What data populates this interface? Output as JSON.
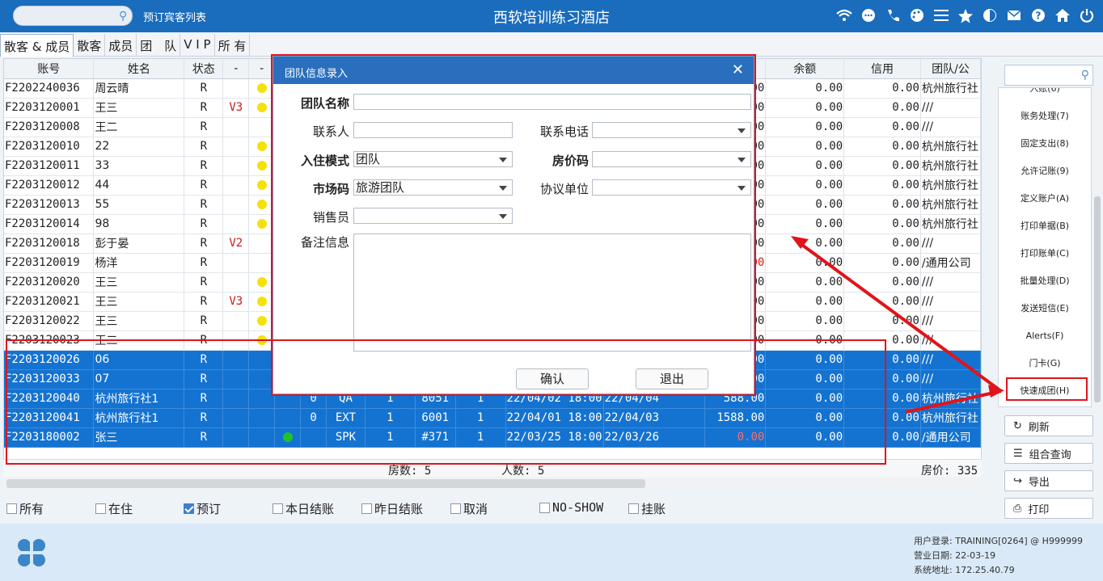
{
  "topbar": {
    "link": "预订宾客列表",
    "title": "西软培训练习酒店"
  },
  "tabs": [
    "散客 & 成员",
    "散客",
    "成员",
    "团　队",
    "V I P",
    "所 有"
  ],
  "table": {
    "headers": [
      "账号",
      "姓名",
      "状态",
      "-",
      "-",
      "",
      "",
      "",
      "",
      "",
      "",
      "",
      "",
      "",
      "余额",
      "信用",
      "团队/公"
    ],
    "rows": [
      [
        "F2202240036",
        "周云晴",
        "R",
        "",
        "yellow",
        "",
        "",
        "",
        "",
        "",
        "",
        "",
        "",
        "00",
        "0.00",
        "0.00",
        "杭州旅行社"
      ],
      [
        "F2203120001",
        "王三",
        "R",
        "V3",
        "yellow",
        "",
        "",
        "",
        "",
        "",
        "",
        "",
        "",
        "00",
        "0.00",
        "0.00",
        "///"
      ],
      [
        "F2203120008",
        "王二",
        "R",
        "",
        "",
        "",
        "",
        "",
        "",
        "",
        "",
        "",
        "",
        "00",
        "0.00",
        "0.00",
        "///"
      ],
      [
        "F2203120010",
        "22",
        "R",
        "",
        "yellow",
        "",
        "",
        "",
        "",
        "",
        "",
        "",
        "",
        "00",
        "0.00",
        "0.00",
        "杭州旅行社"
      ],
      [
        "F2203120011",
        "33",
        "R",
        "",
        "yellow",
        "",
        "",
        "",
        "",
        "",
        "",
        "",
        "",
        "00",
        "0.00",
        "0.00",
        "杭州旅行社"
      ],
      [
        "F2203120012",
        "44",
        "R",
        "",
        "yellow",
        "",
        "",
        "",
        "",
        "",
        "",
        "",
        "",
        "00",
        "0.00",
        "0.00",
        "杭州旅行社"
      ],
      [
        "F2203120013",
        "55",
        "R",
        "",
        "yellow",
        "",
        "",
        "",
        "",
        "",
        "",
        "",
        "",
        "00",
        "0.00",
        "0.00",
        "杭州旅行社"
      ],
      [
        "F2203120014",
        "98",
        "R",
        "",
        "yellow",
        "",
        "",
        "",
        "",
        "",
        "",
        "",
        "",
        "00",
        "0.00",
        "0.00",
        "杭州旅行社"
      ],
      [
        "F2203120018",
        "彭于晏",
        "R",
        "V2",
        "",
        "",
        "",
        "",
        "",
        "",
        "",
        "",
        "",
        "00",
        "0.00",
        "0.00",
        "///"
      ],
      [
        "F2203120019",
        "杨洋",
        "R",
        "",
        "",
        "",
        "",
        "",
        "",
        "",
        "",
        "",
        "",
        "00",
        "0.00",
        "0.00",
        "/通用公司"
      ],
      [
        "F2203120020",
        "王三",
        "R",
        "",
        "yellow",
        "",
        "",
        "",
        "",
        "",
        "",
        "",
        "",
        "00",
        "0.00",
        "0.00",
        "///"
      ],
      [
        "F2203120021",
        "王三",
        "R",
        "V3",
        "yellow",
        "",
        "",
        "",
        "",
        "",
        "",
        "",
        "",
        "00",
        "0.00",
        "0.00",
        "///"
      ],
      [
        "F2203120022",
        "王三",
        "R",
        "",
        "yellow",
        "",
        "",
        "",
        "",
        "",
        "",
        "",
        "",
        "00",
        "0.00",
        "0.00",
        "///"
      ],
      [
        "F2203120023",
        "王二",
        "R",
        "",
        "yellow",
        "",
        "",
        "",
        "",
        "",
        "",
        "",
        "",
        "00",
        "0.00",
        "0.00",
        "///"
      ],
      [
        "F2203120026",
        "06",
        "R",
        "",
        "",
        "",
        "",
        "",
        "",
        "",
        "",
        "",
        "",
        "00",
        "0.00",
        "0.00",
        "///"
      ],
      [
        "F2203120033",
        "07",
        "R",
        "",
        "",
        "",
        "",
        "",
        "",
        "",
        "",
        "",
        "",
        "00",
        "0.00",
        "0.00",
        "///"
      ],
      [
        "F2203120040",
        "杭州旅行社1",
        "R",
        "",
        "",
        "",
        "0",
        "QA",
        "1",
        "8051",
        "1",
        "22/04/02 18:00",
        "22/04/04",
        "588.00",
        "0.00",
        "0.00",
        "杭州旅行社"
      ],
      [
        "F2203120041",
        "杭州旅行社1",
        "R",
        "",
        "",
        "",
        "0",
        "EXT",
        "1",
        "6001",
        "1",
        "22/04/01 18:00",
        "22/04/03",
        "1588.00",
        "0.00",
        "0.00",
        "杭州旅行社"
      ],
      [
        "F2203180002",
        "张三",
        "R",
        "",
        "",
        "green",
        "",
        "SPK",
        "1",
        "#371",
        "1",
        "22/03/25 18:00",
        "22/03/26",
        "0.00",
        "0.00",
        "0.00",
        "/通用公司"
      ]
    ],
    "red_rows_col13": [
      9,
      18
    ]
  },
  "totals": {
    "rooms": "房数: 5",
    "persons": "人数: 5",
    "price": "房价: 335"
  },
  "filters": [
    {
      "label": "所有",
      "on": false
    },
    {
      "label": "在住",
      "on": false
    },
    {
      "label": "预订",
      "on": true
    },
    {
      "label": "本日结账",
      "on": false
    },
    {
      "label": "昨日结账",
      "on": false
    },
    {
      "label": "取消",
      "on": false
    },
    {
      "label": "NO-SHOW",
      "on": false
    },
    {
      "label": "挂账",
      "on": false
    }
  ],
  "menu": [
    "入账(6)",
    "账务处理(7)",
    "固定支出(8)",
    "允许记账(9)",
    "定义账户(A)",
    "打印单据(B)",
    "打印账单(C)",
    "批量处理(D)",
    "发送短信(E)",
    "Alerts(F)",
    "门卡(G)",
    "快速成团(H)"
  ],
  "side_buttons": {
    "refresh": "刷新",
    "query": "组合查询",
    "export": "导出",
    "print": "打印"
  },
  "footer": {
    "user": "用户登录: TRAINING[0264] @ H999999",
    "date": "营业日期: 22-03-19",
    "addr": "系统地址: 172.25.40.79"
  },
  "dialog": {
    "title": "团队信息录入",
    "group_name_label": "团队名称",
    "group_name": "",
    "contact_label": "联系人",
    "contact": "",
    "phone_label": "联系电话",
    "phone": "",
    "mode_label": "入住模式",
    "mode": "团队",
    "rate_label": "房价码",
    "rate": "",
    "market_label": "市场码",
    "market": "旅游团队",
    "agreement_label": "协议单位",
    "agreement": "",
    "sales_label": "销售员",
    "sales": "",
    "remark_label": "备注信息",
    "remark": "",
    "ok": "确认",
    "exit": "退出"
  },
  "colors": {
    "header_blue": "#1a6cbc",
    "selected_row": "#1473d1",
    "highlight": "#e0141b"
  }
}
